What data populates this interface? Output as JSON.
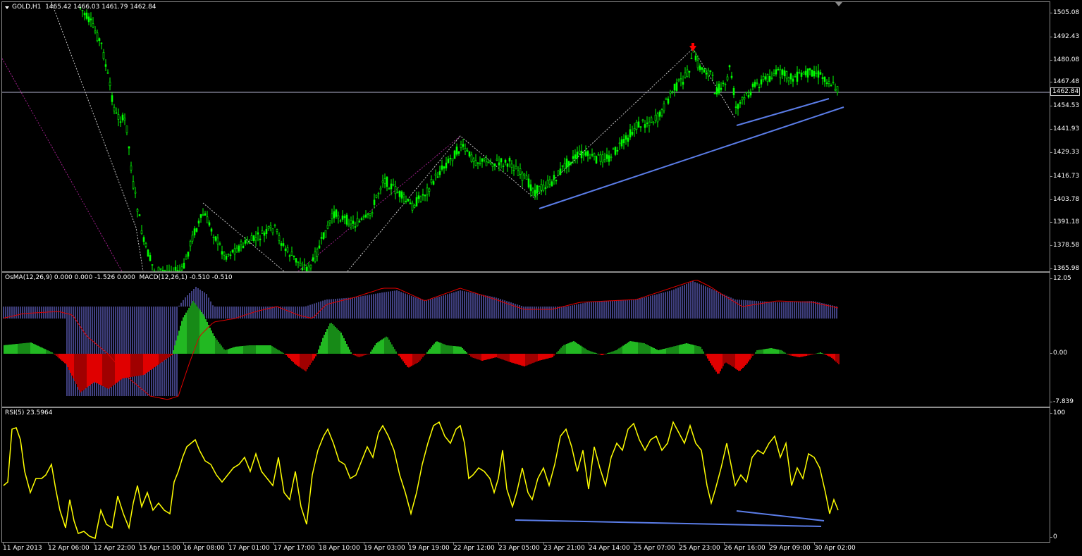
{
  "price_pane": {
    "title": "GOLD,H1  1465.42 1466.03 1461.79 1462.84",
    "symbol": "GOLD",
    "timeframe": "H1",
    "ohlc": {
      "open": 1465.42,
      "high": 1466.03,
      "low": 1461.79,
      "close": 1462.84
    },
    "current_price_label": "1462.84",
    "scale_labels": [
      "1505.08",
      "1492.43",
      "1480.08",
      "1467.48",
      "1454.53",
      "1441.93",
      "1429.33",
      "1416.73",
      "1403.78",
      "1391.18",
      "1378.58",
      "1365.98"
    ],
    "candle_color": "#00ff00",
    "trendline_color": "#5b7de8",
    "marker_color": "#ff0000"
  },
  "macd_pane": {
    "title": "OsMA(12,26,9) 0.000 0.000 -1.526 0.000  MACD(12,26,1) -0.510 -0.510",
    "scale_labels": [
      "12.05",
      "0.00",
      "-7.839"
    ],
    "positive_color": "#22b822",
    "negative_color": "#e00000",
    "macd_hist_color": "#8080ff",
    "signal_color": "#e00000"
  },
  "rsi_pane": {
    "title": "RSI(5) 23.5964",
    "scale_labels": [
      "100",
      "0"
    ],
    "line_color": "#ffff00",
    "trendline_color": "#5b7de8"
  },
  "time_axis": [
    "11 Apr 2013",
    "12 Apr 06:00",
    "12 Apr 22:00",
    "15 Apr 15:00",
    "16 Apr 08:00",
    "17 Apr 01:00",
    "17 Apr 17:00",
    "18 Apr 10:00",
    "19 Apr 03:00",
    "19 Apr 19:00",
    "22 Apr 12:00",
    "23 Apr 05:00",
    "23 Apr 21:00",
    "24 Apr 14:00",
    "25 Apr 07:00",
    "25 Apr 23:00",
    "26 Apr 16:00",
    "29 Apr 09:00",
    "30 Apr 02:00"
  ]
}
